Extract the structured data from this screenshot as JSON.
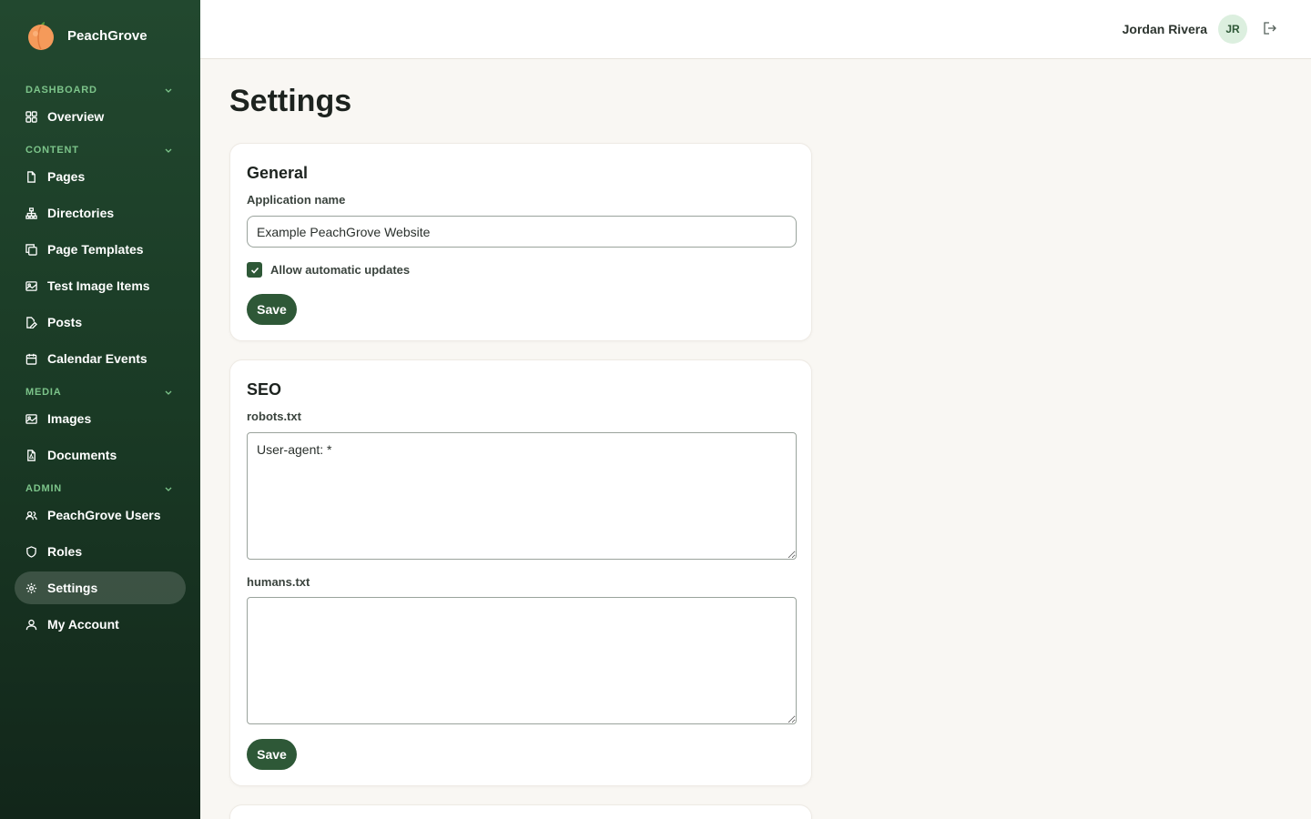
{
  "app": {
    "name": "PeachGrove"
  },
  "sidebar": {
    "sections": [
      {
        "header": "DASHBOARD",
        "items": [
          {
            "label": "Overview",
            "icon": "grid-icon"
          }
        ]
      },
      {
        "header": "CONTENT",
        "items": [
          {
            "label": "Pages",
            "icon": "file-icon"
          },
          {
            "label": "Directories",
            "icon": "sitemap-icon"
          },
          {
            "label": "Page Templates",
            "icon": "copy-icon"
          },
          {
            "label": "Test Image Items",
            "icon": "image-icon"
          },
          {
            "label": "Posts",
            "icon": "file-edit-icon"
          },
          {
            "label": "Calendar Events",
            "icon": "calendar-icon"
          }
        ]
      },
      {
        "header": "MEDIA",
        "items": [
          {
            "label": "Images",
            "icon": "image-icon"
          },
          {
            "label": "Documents",
            "icon": "file-pdf-icon"
          }
        ]
      },
      {
        "header": "ADMIN",
        "items": [
          {
            "label": "PeachGrove Users",
            "icon": "users-icon"
          },
          {
            "label": "Roles",
            "icon": "shield-icon"
          },
          {
            "label": "Settings",
            "icon": "gear-icon",
            "active": true
          },
          {
            "label": "My Account",
            "icon": "user-icon"
          }
        ]
      }
    ]
  },
  "topbar": {
    "user_name": "Jordan Rivera",
    "avatar_initials": "JR"
  },
  "page": {
    "title": "Settings"
  },
  "general": {
    "title": "General",
    "app_name_label": "Application name",
    "app_name_value": "Example PeachGrove Website",
    "auto_updates_label": "Allow automatic updates",
    "auto_updates_checked": true,
    "save_label": "Save"
  },
  "seo": {
    "title": "SEO",
    "robots_label": "robots.txt",
    "robots_value": "User-agent: *",
    "humans_label": "humans.txt",
    "humans_value": "",
    "save_label": "Save"
  },
  "colors": {
    "sidebar": "#1a3a25",
    "accent": "#2e5837",
    "section_header": "#7cc48a",
    "background": "#f9f7f3"
  }
}
